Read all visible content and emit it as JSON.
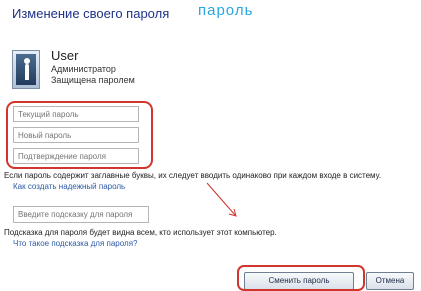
{
  "header": {
    "title": "Изменение своего пароля",
    "title_ext": "пароль"
  },
  "user": {
    "name": "User",
    "role": "Администратор",
    "status": "Защищена паролем"
  },
  "fields": {
    "current_password_placeholder": "Текущий пароль",
    "new_password_placeholder": "Новый пароль",
    "confirm_password_placeholder": "Подтверждение пароля",
    "hint_placeholder": "Введите подсказку для пароля"
  },
  "info": {
    "case_warning": "Если пароль содержит заглавные буквы, их следует вводить одинаково при каждом входе в систему.",
    "strong_password_link": "Как создать надежный пароль",
    "hint_visibility_note": "Подсказка для пароля будет видна всем, кто использует этот компьютер.",
    "hint_link": "Что такое подсказка для пароля?"
  },
  "buttons": {
    "change_password": "Сменить пароль",
    "cancel": "Отмена"
  },
  "colors": {
    "annotation_red": "#d0362e",
    "link_blue": "#2c5aa6",
    "title_blue": "#1e3287"
  }
}
